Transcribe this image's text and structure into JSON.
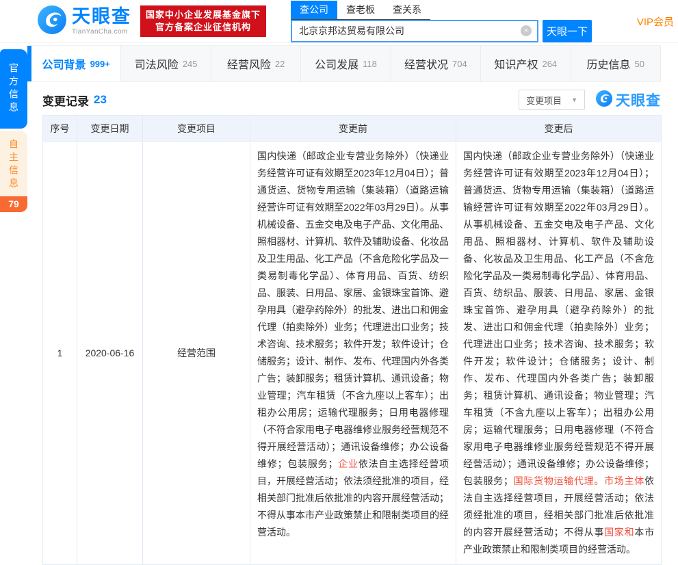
{
  "brand": {
    "logo_text": "天眼查",
    "logo_domain": "TianYanCha.com",
    "badge_line1": "国家中小企业发展基金旗下",
    "badge_line2": "官方备案企业征信机构",
    "colors": {
      "primary": "#0084ff",
      "badge_red": "#d0111b",
      "vip_orange": "#ff8000",
      "highlight_red": "#f2503e"
    }
  },
  "search": {
    "tabs": [
      {
        "label": "查公司"
      },
      {
        "label": "查老板"
      },
      {
        "label": "查关系"
      }
    ],
    "input_value": "北京京邦达贸易有限公司",
    "clear_icon": "×",
    "button_label": "天眼一下",
    "vip_label": "VIP会员"
  },
  "side_tabs": {
    "official_label": "官方信息",
    "self_label": "自主信息",
    "self_count": "79"
  },
  "nav_tabs": [
    {
      "label": "公司背景",
      "count": "999+"
    },
    {
      "label": "司法风险",
      "count": "245"
    },
    {
      "label": "经营风险",
      "count": "22"
    },
    {
      "label": "公司发展",
      "count": "118"
    },
    {
      "label": "经营状况",
      "count": "704"
    },
    {
      "label": "知识产权",
      "count": "264"
    },
    {
      "label": "历史信息",
      "count": "50"
    }
  ],
  "section": {
    "title": "变更记录",
    "count": "23",
    "filter_label": "变更项目",
    "filter_caret": "▼",
    "watermark_text": "天眼查"
  },
  "table": {
    "headers": [
      "序号",
      "变更日期",
      "变更项目",
      "变更前",
      "变更后"
    ],
    "rows": [
      {
        "no": "1",
        "date": "2020-06-16",
        "item": "经营范围",
        "before_segments": [
          {
            "text": "国内快递（邮政企业专营业务除外）（快递业务经营许可证有效期至2023年12月04日）；普通货运、货物专用运输（集装箱）（道路运输经营许可证有效期至2022年03月29日）。从事机械设备、五金交电及电子产品、文化用品、照相器材、计算机、软件及辅助设备、化妆品及卫生用品、化工产品（不含危险化学品及一类易制毒化学品）、体育用品、百货、纺织品、服装、日用品、家居、金银珠宝首饰、避孕用具（避孕药除外）的批发、进出口和佣金代理（拍卖除外）业务；代理进出口业务；技术咨询、技术服务；软件开发；软件设计；仓储服务；设计、制作、发布、代理国内外各类广告；装卸服务；租赁计算机、通讯设备；物业管理；汽车租赁（不含九座以上客车）；出租办公用房；运输代理服务；日用电器修理（不符合家用电子电器维修业服务经营规范不得开展经营活动）；通讯设备维修；办公设备维修；包装服务；",
            "red": false
          },
          {
            "text": "企业",
            "red": true
          },
          {
            "text": "依法自主选择经营项目，开展经营活动；依法须经批准的项目，经相关部门批准后依批准的内容开展经营活动；不得从事本市产业政策禁止和限制类项目的经营活动。",
            "red": false
          }
        ],
        "after_segments": [
          {
            "text": "国内快递（邮政企业专营业务除外）（快递业务经营许可证有效期至2023年12月04日）；普通货运、货物专用运输（集装箱）（道路运输经营许可证有效期至2022年03月29日）。从事机械设备、五金交电及电子产品、文化用品、照相器材、计算机、软件及辅助设备、化妆品及卫生用品、化工产品（不含危险化学品及一类易制毒化学品）、体育用品、百货、纺织品、服装、日用品、家居、金银珠宝首饰、避孕用具（避孕药除外）的批发、进出口和佣金代理（拍卖除外）业务；代理进出口业务；技术咨询、技术服务；软件开发；软件设计；仓储服务；设计、制作、发布、代理国内外各类广告；装卸服务；租赁计算机、通讯设备；物业管理；汽车租赁（不含九座以上客车）；出租办公用房；运输代理服务；日用电器修理（不符合家用电子电器维修业服务经营规范不得开展经营活动）；通讯设备维修；办公设备维修；包装服务；",
            "red": false
          },
          {
            "text": "国际货物运输代理。市场主体",
            "red": true
          },
          {
            "text": "依法自主选择经营项目，开展经营活动；依法须经批准的项目，经相关部门批准后依批准的内容开展经营活动；不得从事",
            "red": false
          },
          {
            "text": "国家和",
            "red": true
          },
          {
            "text": "本市产业政策禁止和限制类项目的经营活动。",
            "red": false
          }
        ]
      }
    ]
  }
}
